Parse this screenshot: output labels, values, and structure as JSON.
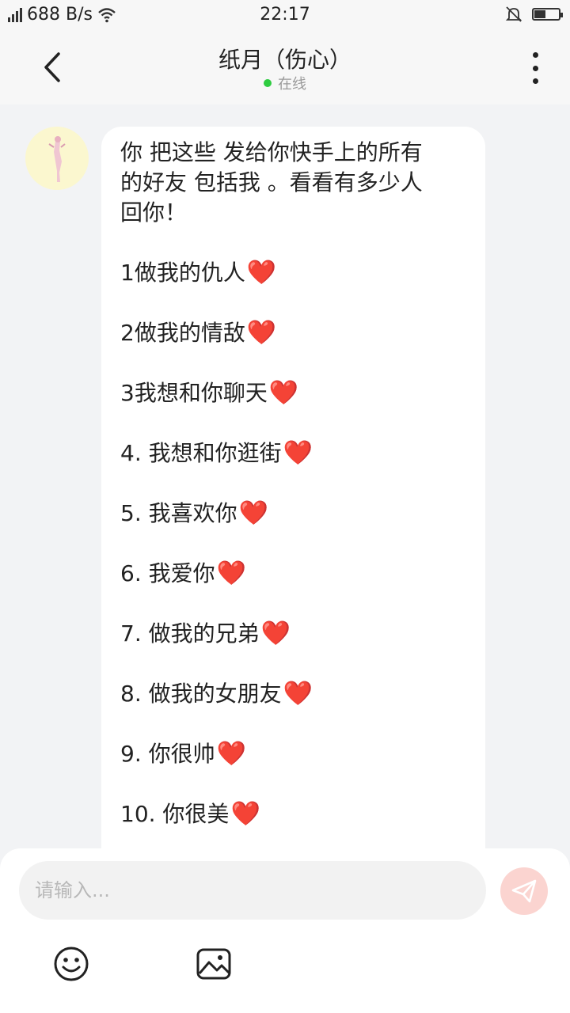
{
  "status_bar": {
    "network_speed": "688 B/s",
    "time": "22:17",
    "signal_icon": "signal-icon",
    "wifi_icon": "wifi-icon",
    "mute_icon": "bell-off-icon",
    "battery_icon": "battery-icon",
    "battery_level": 0.45
  },
  "header": {
    "title": "纸月（伤心）",
    "status": "在线",
    "status_color": "#2ecc40"
  },
  "message": {
    "intro_lines": [
      "你 把这些 发给你快手上的所有",
      "的好友 包括我 。看看有多少人",
      "回你！"
    ],
    "items": [
      "1做我的仇人",
      "2做我的情敌",
      "3我想和你聊天",
      "4. 我想和你逛街",
      "5. 我喜欢你",
      "6. 我爱你",
      "7. 做我的兄弟",
      "8. 做我的女朋友",
      "9. 你很帅",
      "10. 你很美"
    ],
    "heart": "❤️"
  },
  "input": {
    "placeholder": "请输入...",
    "send_icon": "send-icon",
    "emoji_icon": "emoji-icon",
    "image_icon": "image-icon"
  },
  "colors": {
    "background": "#f2f3f5",
    "bubble": "#ffffff",
    "heart": "#e0242b",
    "send_button": "#fbd4d0"
  }
}
